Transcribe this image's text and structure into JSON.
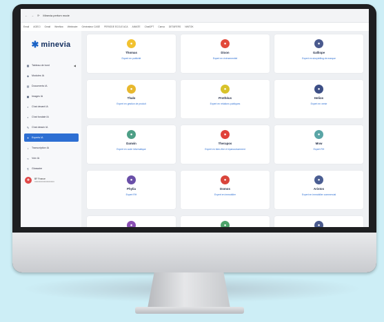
{
  "browser": {
    "title": "Minevia perfom mode",
    "bookmarks": [
      "Email",
      "AGECI",
      "Gmail",
      "Weeflow",
      "Webinaire",
      "Générateur CASE",
      "PERIODE ECOLE ACA",
      "AIMATE",
      "ChatGPT",
      "Canva",
      "DETAFERS",
      "NINTOK"
    ]
  },
  "sidebar": {
    "logo_text": "minevia",
    "items": [
      {
        "label": "Tableau de bord",
        "icon": "home-icon"
      },
      {
        "label": "Modules IA",
        "icon": "cube-icon"
      },
      {
        "label": "Documents IA",
        "icon": "document-icon"
      },
      {
        "label": "Images IA",
        "icon": "image-icon"
      },
      {
        "label": "Chat devant IA",
        "icon": "chat-icon"
      },
      {
        "label": "Chat fondale IA",
        "icon": "chat-icon"
      },
      {
        "label": "Chat dessin IA",
        "icon": "brush-icon"
      },
      {
        "label": "Experts IA",
        "icon": "expert-icon",
        "active": true
      },
      {
        "label": "Transcription IA",
        "icon": "mic-icon"
      },
      {
        "label": "Voix IA",
        "icon": "wave-icon"
      },
      {
        "label": "Glossaire",
        "icon": "book-icon"
      }
    ],
    "user": {
      "name": "BF France",
      "sub": "xxxxxxxxxxxxxxxxx"
    }
  },
  "experts": [
    {
      "name": "Thomas",
      "role": "Expert en publicité",
      "color": "#f2c230"
    },
    {
      "name": "Dixon",
      "role": "Expert en événementiel",
      "color": "#e24a3b"
    },
    {
      "name": "Galliope",
      "role": "Expert en storytelling de marque",
      "color": "#4a5a8e"
    },
    {
      "name": "Thalo",
      "role": "Expert en gestion de produit",
      "color": "#e8b82e"
    },
    {
      "name": "Prothéus",
      "role": "Expert en relations publiques",
      "color": "#d8c22a"
    },
    {
      "name": "Helios",
      "role": "Expert en vente",
      "color": "#3d4f86"
    },
    {
      "name": "Darwin",
      "role": "Expert en code informatique",
      "color": "#4d9f86"
    },
    {
      "name": "Therapos",
      "role": "Expert en bien-être et épanouissement",
      "color": "#e0413a"
    },
    {
      "name": "Mnw",
      "role": "Expert RH",
      "color": "#5aa5a6"
    },
    {
      "name": "Phylia",
      "role": "Expert RH",
      "color": "#6a4fa8"
    },
    {
      "name": "Domos",
      "role": "Expert en immobilier",
      "color": "#d9453b"
    },
    {
      "name": "Aristos",
      "role": "Expert en immobilier commercial",
      "color": "#4b5e92"
    },
    {
      "name": "",
      "role": "",
      "color": "#8a4fb4"
    },
    {
      "name": "",
      "role": "",
      "color": "#4da36a"
    },
    {
      "name": "",
      "role": "",
      "color": "#4a5a8e"
    }
  ]
}
